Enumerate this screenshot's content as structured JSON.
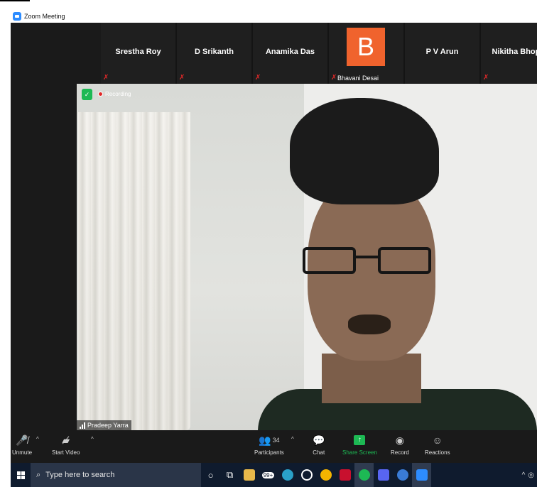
{
  "window": {
    "title": "Zoom Meeting"
  },
  "participants_strip": [
    {
      "name": "Srestha Roy",
      "muted": true
    },
    {
      "name": "D Srikanth",
      "muted": true
    },
    {
      "name": "Anamika Das",
      "muted": true
    },
    {
      "name": "Bhavani Desai",
      "avatar_letter": "B",
      "avatar_color": "#f0632d",
      "muted": true
    },
    {
      "name": "P V Arun",
      "muted": false
    },
    {
      "name": "Nikitha Bhopc",
      "muted": true
    }
  ],
  "active_speaker": {
    "name": "Pradeep Yarra",
    "recording_label": "Recording"
  },
  "controls": {
    "unmute": "Unmute",
    "start_video": "Start Video",
    "participants": "Participants",
    "participants_count": "34",
    "chat": "Chat",
    "share_screen": "Share Screen",
    "record": "Record",
    "reactions": "Reactions"
  },
  "taskbar": {
    "search_placeholder": "Type here to search",
    "store_badge": "99+",
    "tray_text": "^"
  },
  "colors": {
    "accent_green": "#1db954",
    "zoom_blue": "#2d8cff",
    "muted_red": "#e02828"
  }
}
